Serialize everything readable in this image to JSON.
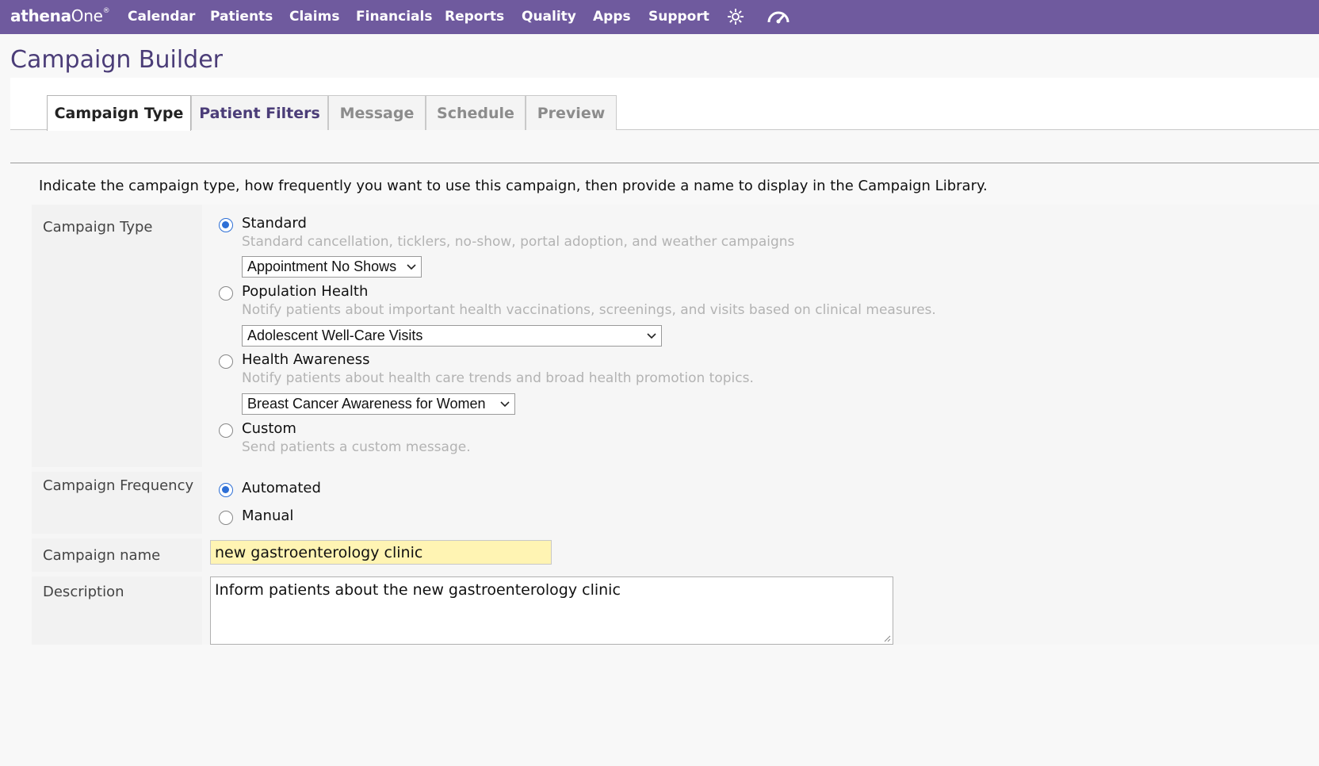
{
  "topnav": {
    "logo_main": "athena",
    "logo_suffix": "One",
    "logo_mark": "®",
    "items": [
      "Calendar",
      "Patients",
      "Claims",
      "Financials",
      "Reports",
      "Quality",
      "Apps",
      "Support"
    ],
    "icons": [
      "gear-icon",
      "speedometer-icon"
    ]
  },
  "page": {
    "title": "Campaign Builder"
  },
  "tabs": [
    {
      "label": "Campaign Type",
      "state": "active"
    },
    {
      "label": "Patient Filters",
      "state": "enabled"
    },
    {
      "label": "Message",
      "state": "disabled"
    },
    {
      "label": "Schedule",
      "state": "disabled"
    },
    {
      "label": "Preview",
      "state": "disabled"
    }
  ],
  "intro": "Indicate the campaign type, how frequently you want to use this campaign, then provide a name to display in the Campaign Library.",
  "campaign_type": {
    "label": "Campaign Type",
    "options": [
      {
        "label": "Standard",
        "description": "Standard cancellation, ticklers, no-show, portal adoption, and weather campaigns",
        "selected": true,
        "dropdown_value": "Appointment No Shows"
      },
      {
        "label": "Population Health",
        "description": "Notify patients about important health vaccinations, screenings, and visits based on clinical measures.",
        "selected": false,
        "dropdown_value": "Adolescent Well-Care Visits"
      },
      {
        "label": "Health Awareness",
        "description": "Notify patients about health care trends and broad health promotion topics.",
        "selected": false,
        "dropdown_value": "Breast Cancer Awareness for Women"
      },
      {
        "label": "Custom",
        "description": "Send patients a custom message.",
        "selected": false
      }
    ]
  },
  "campaign_frequency": {
    "label": "Campaign Frequency",
    "options": [
      {
        "label": "Automated",
        "selected": true
      },
      {
        "label": "Manual",
        "selected": false
      }
    ]
  },
  "campaign_name": {
    "label": "Campaign name",
    "value": "new gastroenterology clinic"
  },
  "description": {
    "label": "Description",
    "value": "Inform patients about the new gastroenterology clinic"
  },
  "colors": {
    "nav_bg": "#6f5a9e",
    "title": "#4b3d78",
    "radio_selected": "#2d6fd6",
    "name_field_bg": "#fff4b3"
  }
}
